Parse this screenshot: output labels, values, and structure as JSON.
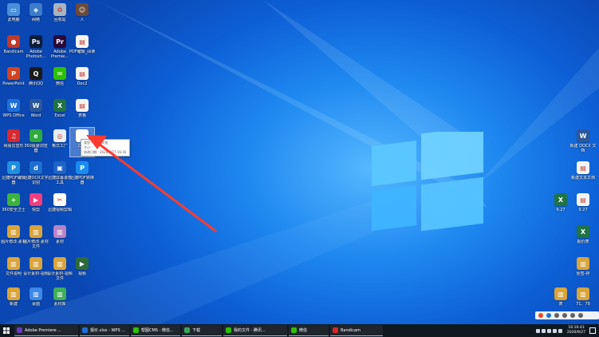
{
  "desktop": {
    "icons": [
      {
        "id": "computer",
        "label": "此电脑",
        "icon": "computer-icon",
        "color": "#4a90d9",
        "glyph": "▭"
      },
      {
        "id": "network",
        "label": "网络",
        "icon": "network-icon",
        "color": "#3d7cc9",
        "glyph": "◈"
      },
      {
        "id": "recycle",
        "label": "回收站",
        "icon": "recycle-bin-icon",
        "color": "#a9b4c2",
        "glyph": "♻"
      },
      {
        "id": "person",
        "label": "人",
        "icon": "person-photo-icon",
        "color": "#6b4a3a",
        "glyph": "☺"
      },
      {
        "id": "bandicam",
        "label": "Bandicam",
        "icon": "bandicam-icon",
        "color": "#c0392b",
        "glyph": "●"
      },
      {
        "id": "photoshop",
        "label": "Adobe Photosh...",
        "icon": "photoshop-icon",
        "color": "#0b1d3a",
        "glyph": "Ps"
      },
      {
        "id": "premiere",
        "label": "Adobe Premie...",
        "icon": "premiere-icon",
        "color": "#2a0a3a",
        "glyph": "Pr"
      },
      {
        "id": "pdf",
        "label": "PDF编辑_阅读",
        "icon": "pdf-file-icon",
        "color": "#f4f4f4",
        "glyph": "▤"
      },
      {
        "id": "powerpoint",
        "label": "PowerPoint",
        "icon": "powerpoint-icon",
        "color": "#d04423",
        "glyph": "P"
      },
      {
        "id": "qq",
        "label": "腾讯QQ",
        "icon": "qq-icon",
        "color": "#1a1a1a",
        "glyph": "Q"
      },
      {
        "id": "wechat",
        "label": "微信",
        "icon": "wechat-icon",
        "color": "#2dc100",
        "glyph": "✉"
      },
      {
        "id": "doc2",
        "label": "Doc2",
        "icon": "document-icon",
        "color": "#f4f4f4",
        "glyph": "▤"
      },
      {
        "id": "wps",
        "label": "WPS Office",
        "icon": "wps-icon",
        "color": "#1e6fd9",
        "glyph": "W"
      },
      {
        "id": "word",
        "label": "Word",
        "icon": "word-icon",
        "color": "#2b579a",
        "glyph": "W"
      },
      {
        "id": "excel",
        "label": "Excel",
        "icon": "excel-icon",
        "color": "#217346",
        "glyph": "X"
      },
      {
        "id": "doc3",
        "label": "表格",
        "icon": "document-icon",
        "color": "#f4f4f4",
        "glyph": "▤"
      },
      {
        "id": "netease",
        "label": "网易云音乐",
        "icon": "netease-music-icon",
        "color": "#d6282f",
        "glyph": "♫"
      },
      {
        "id": "ie360",
        "label": "360极速浏览器",
        "icon": "browser-icon",
        "color": "#2eaa3f",
        "glyph": "e"
      },
      {
        "id": "ai",
        "label": "格式工厂",
        "icon": "format-factory-icon",
        "color": "#e8eef5",
        "glyph": "◎"
      },
      {
        "id": "doc-sel",
        "label": "Doc",
        "icon": "blank-document-icon",
        "color": "#ffffff",
        "glyph": ""
      },
      {
        "id": "xunjie1",
        "label": "迅捷PDF编辑器",
        "icon": "pdf-editor-icon",
        "color": "#1f8fe0",
        "glyph": "P"
      },
      {
        "id": "xunjie2",
        "label": "迅捷OCR文字识别",
        "icon": "ocr-icon",
        "color": "#1b6fd1",
        "glyph": "d"
      },
      {
        "id": "xunjie3",
        "label": "迅捷屏幕录像工具",
        "icon": "screen-recorder-icon",
        "color": "#1e63c8",
        "glyph": "▣"
      },
      {
        "id": "xunjie4",
        "label": "迅捷PDF转换器",
        "icon": "pdf-converter-icon",
        "color": "#1a8cf0",
        "glyph": "P"
      },
      {
        "id": "tools360",
        "label": "360安全卫士",
        "icon": "shield-icon",
        "color": "#3db33d",
        "glyph": "+"
      },
      {
        "id": "kuaijian",
        "label": "快剪",
        "icon": "video-editor-icon",
        "color": "#f23d7f",
        "glyph": "▶"
      },
      {
        "id": "cut",
        "label": "迅捷视频剪辑",
        "icon": "scissors-icon",
        "color": "#ffffff",
        "glyph": "✂"
      },
      {
        "id": "zip1",
        "label": "图片修改-素材",
        "icon": "archive-icon",
        "color": "#d9a43a",
        "glyph": "▥"
      },
      {
        "id": "zip2",
        "label": "图片修改-素材文件",
        "icon": "archive-icon",
        "color": "#d9a43a",
        "glyph": "▥"
      },
      {
        "id": "zip3",
        "label": "素材",
        "icon": "archive-icon",
        "color": "#b983c8",
        "glyph": "▥"
      },
      {
        "id": "zip4",
        "label": "文件说明",
        "icon": "archive-icon",
        "color": "#d9a43a",
        "glyph": "▥"
      },
      {
        "id": "zip5",
        "label": "设计素材-视频",
        "icon": "archive-icon",
        "color": "#d9a43a",
        "glyph": "▥"
      },
      {
        "id": "zip6",
        "label": "设计素材-视频文件",
        "icon": "archive-icon",
        "color": "#d9a43a",
        "glyph": "▥"
      },
      {
        "id": "video",
        "label": "视频",
        "icon": "video-file-icon",
        "color": "#2e6b3a",
        "glyph": "▶"
      },
      {
        "id": "zip7",
        "label": "新建",
        "icon": "archive-icon",
        "color": "#d9a43a",
        "glyph": "▥"
      },
      {
        "id": "zip8",
        "label": "桌面",
        "icon": "archive-icon",
        "color": "#3b88e6",
        "glyph": "▥"
      },
      {
        "id": "zip9",
        "label": "素材库",
        "icon": "archive-icon",
        "color": "#3fae5a",
        "glyph": "▥"
      },
      {
        "id": "r-docx",
        "label": "新建 DOCX 文档",
        "icon": "word-file-icon",
        "color": "#2b579a",
        "glyph": "W"
      },
      {
        "id": "r-txt",
        "label": "新建文本文档",
        "icon": "text-file-icon",
        "color": "#f4f4f4",
        "glyph": "▤"
      },
      {
        "id": "r-927a",
        "label": "9.27",
        "icon": "excel-file-icon",
        "color": "#217346",
        "glyph": "X"
      },
      {
        "id": "r-927b",
        "label": "9.27",
        "icon": "document-icon",
        "color": "#f4f4f4",
        "glyph": "▤"
      },
      {
        "id": "r-xls",
        "label": "报价表",
        "icon": "excel-file-icon",
        "color": "#217346",
        "glyph": "X"
      },
      {
        "id": "r-zip",
        "label": "便签-存",
        "icon": "archive-icon",
        "color": "#d9a43a",
        "glyph": "▥"
      },
      {
        "id": "r-a",
        "label": "表",
        "icon": "archive-icon",
        "color": "#d9a43a",
        "glyph": "▥"
      },
      {
        "id": "r-b",
        "label": "71、79",
        "icon": "archive-icon",
        "color": "#d9a43a",
        "glyph": "▥"
      }
    ],
    "tooltip_lines": [
      "类型：DOC 文档",
      "大小：",
      "修改日期：2020/9/27 16:16"
    ]
  },
  "taskbar": {
    "items": [
      {
        "label": "Adobe Premiere ...",
        "icon": "premiere-icon",
        "color": "#6c3bbf"
      },
      {
        "label": "报价.xlsx - WPS ...",
        "icon": "wps-icon",
        "color": "#1e6fd9"
      },
      {
        "label": "帮图CMS - 微信...",
        "icon": "wechat-icon",
        "color": "#2dc100"
      },
      {
        "label": "下载",
        "icon": "download-icon",
        "color": "#3aa55a"
      },
      {
        "label": "我的文件 - 腾讯...",
        "icon": "browser-icon",
        "color": "#2dc100"
      },
      {
        "label": "微信",
        "icon": "wechat-icon",
        "color": "#2dc100"
      },
      {
        "label": "Bandicam",
        "icon": "bandicam-icon",
        "color": "#d62828"
      }
    ],
    "clock_time": "16:16:43",
    "clock_date": "2020/9/27"
  }
}
